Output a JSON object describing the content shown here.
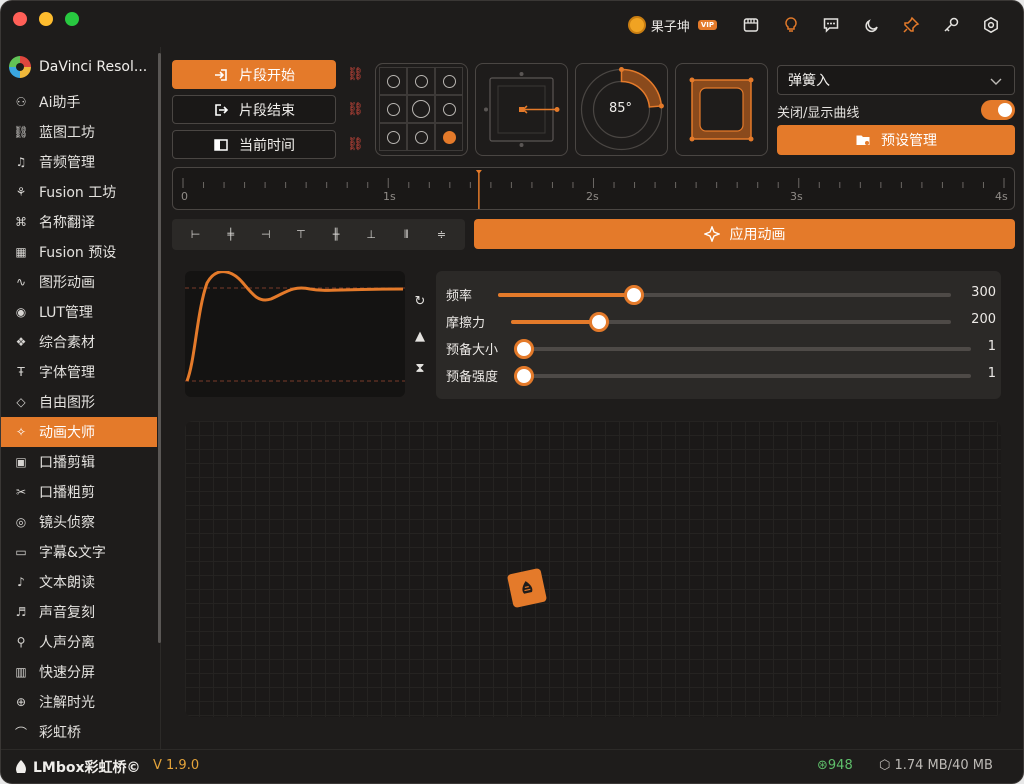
{
  "user": {
    "name": "果子坤",
    "badge": "VIP"
  },
  "app": {
    "name": "DaVinci Resol..."
  },
  "sidebar": {
    "items": [
      {
        "label": "Ai助手",
        "icon": "robot-icon"
      },
      {
        "label": "蓝图工坊",
        "icon": "blueprint-icon"
      },
      {
        "label": "音频管理",
        "icon": "headphones-icon"
      },
      {
        "label": "Fusion 工坊",
        "icon": "fusion-nodes-icon"
      },
      {
        "label": "名称翻译",
        "icon": "translate-icon"
      },
      {
        "label": "Fusion 预设",
        "icon": "preset-grid-icon"
      },
      {
        "label": "图形动画",
        "icon": "shape-animation-icon"
      },
      {
        "label": "LUT管理",
        "icon": "lut-icon"
      },
      {
        "label": "综合素材",
        "icon": "assets-icon"
      },
      {
        "label": "字体管理",
        "icon": "font-icon"
      },
      {
        "label": "自由图形",
        "icon": "free-shape-icon"
      },
      {
        "label": "动画大师",
        "icon": "sparkle-icon"
      },
      {
        "label": "口播剪辑",
        "icon": "clapper-icon"
      },
      {
        "label": "口播粗剪",
        "icon": "scissors-icon"
      },
      {
        "label": "镜头侦察",
        "icon": "camera-scan-icon"
      },
      {
        "label": "字幕&文字",
        "icon": "subtitle-icon"
      },
      {
        "label": "文本朗读",
        "icon": "microphone-icon"
      },
      {
        "label": "声音复刻",
        "icon": "voice-clone-icon"
      },
      {
        "label": "人声分离",
        "icon": "vocal-split-icon"
      },
      {
        "label": "快速分屏",
        "icon": "split-screen-icon"
      },
      {
        "label": "注解时光",
        "icon": "annotation-icon"
      },
      {
        "label": "彩虹桥",
        "icon": "rainbow-icon"
      }
    ],
    "active_index": 11
  },
  "actions": {
    "clip_start": "片段开始",
    "clip_end": "片段结束",
    "current_time": "当前时间"
  },
  "rotation": {
    "value": "85°"
  },
  "preset": {
    "selected": "弹簧入",
    "toggle_label": "关闭/显示曲线",
    "toggle_on": true,
    "manage_label": "预设管理"
  },
  "timeline": {
    "ticks": [
      "0",
      "1s",
      "2s",
      "3s",
      "4s"
    ],
    "playhead_seconds": 1.5
  },
  "apply_label": "应用动画",
  "params": [
    {
      "label": "频率",
      "value": "300",
      "fraction": 0.3
    },
    {
      "label": "摩擦力",
      "value": "200",
      "fraction": 0.2
    },
    {
      "label": "预备大小",
      "value": "1",
      "fraction": 0.0
    },
    {
      "label": "预备强度",
      "value": "1",
      "fraction": 0.0
    }
  ],
  "footer": {
    "brand": "LMbox彩虹桥©",
    "version": "V 1.9.0",
    "count": "948",
    "memory": "1.74 MB/40 MB"
  },
  "colors": {
    "accent": "#e47a2a",
    "bg": "#1e1c1b",
    "link_red": "#d0483c",
    "count_green": "#5fbf6b"
  }
}
